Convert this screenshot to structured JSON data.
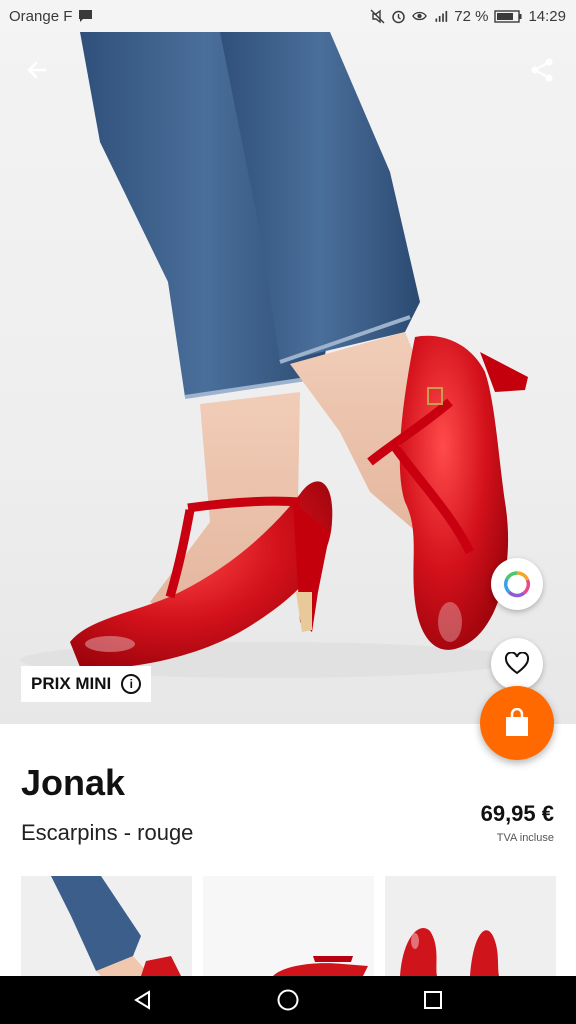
{
  "status_bar": {
    "carrier": "Orange F",
    "battery": "72 %",
    "time": "14:29"
  },
  "product": {
    "badge": "PRIX MINI",
    "brand": "Jonak",
    "name": "Escarpins - rouge",
    "price": "69,95 €",
    "tax_note": "TVA incluse"
  },
  "icons": {
    "back": "arrow-left-icon",
    "share": "share-icon",
    "info": "info-icon",
    "colors": "color-wheel-icon",
    "favorite": "heart-icon",
    "cart": "shopping-bag-icon"
  },
  "colors": {
    "accent": "#ff6900",
    "product": "#d0141c",
    "denim": "#3b5f8a"
  },
  "thumbnails": [
    "Jonak - rouge 1",
    "Jonak - rouge 2",
    "Jonak - rouge 3"
  ]
}
